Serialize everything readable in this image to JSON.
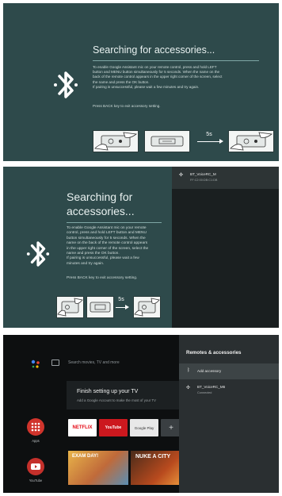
{
  "pairing_screen_wide": {
    "title": "Searching for accessories...",
    "instructions": [
      "To enable Google Assistant mic on your remote control, press and hold LEFT",
      "button and MENU button simultaneously for 5 seconds. When the name on the",
      "back of the remote control appears in the upper right corner of the screen, select",
      "the name and press the OK button.",
      "If pairing is unsuccessful, please wait a few minutes and try again."
    ],
    "press_back": "Press BACK key to exit accessory setting.",
    "timer_label": "5s"
  },
  "pairing_screen_split": {
    "title_line1": "Searching for",
    "title_line2": "accessories...",
    "instructions": [
      "To enable Google Assistant mic on your remote",
      "control, press and hold LEFT button and MENU",
      "button simultaneously for 5 seconds. When the",
      "name on the back of the remote control appears",
      "in the upper right corner of the screen, select the",
      "name and press the OK button.",
      "If pairing is unsuccessful, please wait a few",
      "minutes and try again."
    ],
    "press_back": "Press BACK key to exit accessory setting.",
    "timer_label": "5s",
    "found_device": {
      "name": "BT_VoiceRC_M",
      "address": "FF:C2:00:DB:C1:DB"
    }
  },
  "home_screen": {
    "search_placeholder": "Search movies, TV and more",
    "setup_card": {
      "title": "Finish setting up your TV",
      "subtitle": "Add a Google Account to make the most of your TV"
    },
    "apps_label": "Apps",
    "youtube_label": "YouTube",
    "tiles": [
      "NETFLIX",
      "YouTube",
      "Google Play",
      "+"
    ],
    "thumbnails": [
      "EXAM DAY!",
      "NUKE A CITY"
    ],
    "drawer": {
      "title": "Remotes & accessories",
      "add_label": "Add accessory",
      "device_name": "BT_VoiceRC_M6",
      "device_status": "Connected"
    }
  },
  "colors": {
    "teal_bg": "#2e4a4b",
    "dark_bg": "#0d0f10",
    "drawer_bg": "#2a2f31",
    "netflix_red": "#e50914",
    "youtube_red": "#cc181e"
  }
}
